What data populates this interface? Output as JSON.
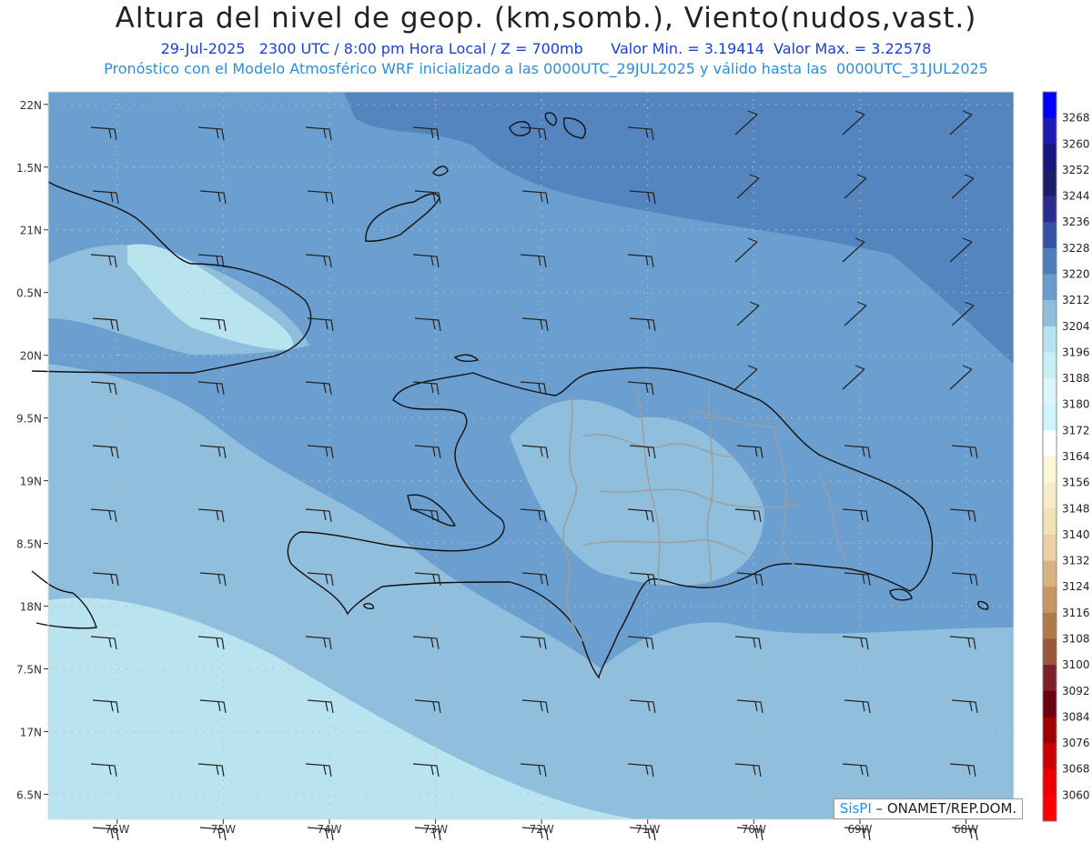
{
  "header": {
    "title": "Altura del nivel de geop. (km,somb.), Viento(nudos,vast.)",
    "line1": "29-Jul-2025   2300 UTC / 8:00 pm Hora Local / Z = 700mb      Valor Min. = 3.19414  Valor Max. = 3.22578",
    "line2": "Pronóstico con el Modelo Atmosférico WRF inicializado a las 0000UTC_29JUL2025 y válido hasta las  0000UTC_31JUL2025"
  },
  "map": {
    "lon_range": [
      -76.65,
      -67.55
    ],
    "lat_range": [
      16.3,
      22.1
    ],
    "lat_labels": [
      {
        "lat": 22.0,
        "text": "22N"
      },
      {
        "lat": 21.5,
        "text": "1.5N"
      },
      {
        "lat": 21.0,
        "text": "21N"
      },
      {
        "lat": 20.5,
        "text": "0.5N"
      },
      {
        "lat": 20.0,
        "text": "20N"
      },
      {
        "lat": 19.5,
        "text": "9.5N"
      },
      {
        "lat": 19.0,
        "text": "19N"
      },
      {
        "lat": 18.5,
        "text": "8.5N"
      },
      {
        "lat": 18.0,
        "text": "18N"
      },
      {
        "lat": 17.5,
        "text": "7.5N"
      },
      {
        "lat": 17.0,
        "text": "17N"
      },
      {
        "lat": 16.5,
        "text": "6.5N"
      }
    ],
    "lon_labels": [
      {
        "lon": -76,
        "text": "76W"
      },
      {
        "lon": -75,
        "text": "75W"
      },
      {
        "lon": -74,
        "text": "74W"
      },
      {
        "lon": -73,
        "text": "73W"
      },
      {
        "lon": -72,
        "text": "72W"
      },
      {
        "lon": -71,
        "text": "71W"
      },
      {
        "lon": -70,
        "text": "70W"
      },
      {
        "lon": -69,
        "text": "69W"
      },
      {
        "lon": -68,
        "text": "68W"
      }
    ],
    "grid": true,
    "shading_levels": [
      "#b9e3ef",
      "#8fbfdd",
      "#6a9fcf",
      "#5585bf"
    ]
  },
  "colorbar": {
    "levels": [
      "3268",
      "3260",
      "3252",
      "3244",
      "3236",
      "3228",
      "3220",
      "3212",
      "3204",
      "3196",
      "3188",
      "3180",
      "3172",
      "3164",
      "3156",
      "3148",
      "3140",
      "3132",
      "3124",
      "3116",
      "3108",
      "3100",
      "3092",
      "3084",
      "3076",
      "3068",
      "3060"
    ],
    "colors": [
      "#0000ff",
      "#1a1ab4",
      "#161680",
      "#1c1c6a",
      "#2a2c8e",
      "#3550a5",
      "#4f7dbb",
      "#6a9dcd",
      "#8fbfdd",
      "#b6e2ef",
      "#c8eff6",
      "#dcf5f8",
      "#ccf6fb",
      "#ffffff",
      "#fcf6d8",
      "#f8ecc8",
      "#f1e2b8",
      "#ead2a4",
      "#d8b282",
      "#c79562",
      "#b07a48",
      "#9a5638",
      "#7e1e2a",
      "#6a0010",
      "#a00000",
      "#cc0000",
      "#ee0000",
      "#ff0000"
    ]
  },
  "credit": {
    "brand": "SisPI",
    "org": " – ONAMET/REP.DOM."
  }
}
